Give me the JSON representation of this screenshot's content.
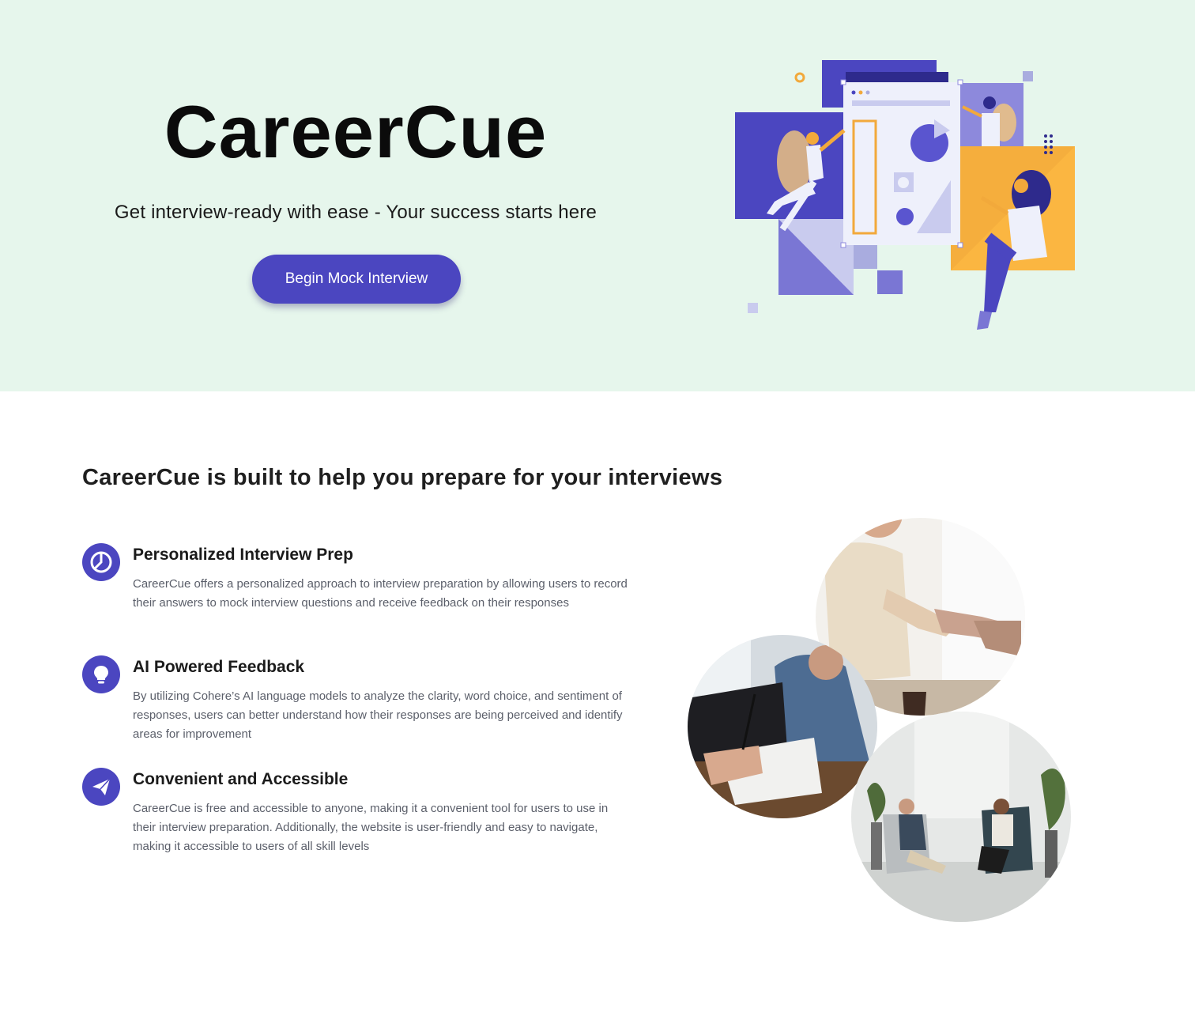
{
  "hero": {
    "title": "CareerCue",
    "subtitle": "Get interview-ready with ease - Your success starts here",
    "cta_label": "Begin Mock Interview",
    "background": "#e6f6ec",
    "accent": "#4b46c0"
  },
  "features": {
    "heading": "CareerCue is built to help you prepare for your interviews",
    "items": [
      {
        "icon": "pie-chart-icon",
        "title": "Personalized Interview Prep",
        "text": "CareerCue offers a personalized approach to interview preparation by allowing users to record their answers to mock interview questions and receive feedback on their responses"
      },
      {
        "icon": "lightbulb-icon",
        "title": "AI Powered Feedback",
        "text": "By utilizing Cohere’s AI language models to analyze the clarity, word choice, and sentiment of responses, users can better understand how their responses are being perceived and identify areas for improvement"
      },
      {
        "icon": "paper-plane-icon",
        "title": "Convenient and Accessible",
        "text": "CareerCue is free and accessible to anyone, making it a convenient tool for users to use in their interview preparation. Additionally, the website is user-friendly and easy to navigate, making it accessible to users of all skill levels"
      }
    ]
  },
  "photos": [
    "handshake-photo",
    "laptop-writing-photo",
    "interview-room-photo"
  ]
}
